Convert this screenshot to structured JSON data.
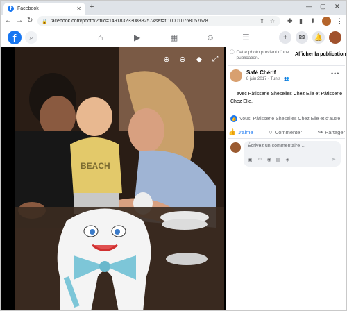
{
  "browser": {
    "tab_title": "Facebook",
    "tab_favicon": "f",
    "tab_close": "✕",
    "new_tab": "+",
    "url": "facebook.com/photo/?fbid=1491832330888257&set=t.100010768057678",
    "controls": {
      "minimize": "—",
      "maximize": "▢",
      "close": "✕"
    }
  },
  "fb_nav": {
    "logo": "f",
    "icons": [
      "home-icon",
      "watch-icon",
      "marketplace-icon",
      "groups-icon",
      "menu-icon"
    ]
  },
  "photo_overlay_icons": [
    "zoom-in-icon",
    "zoom-out-icon",
    "tag-icon",
    "fullscreen-icon"
  ],
  "panel": {
    "notice_text": "Cette photo provient d'une publication.",
    "show_post_label": "Afficher la publication",
    "author_name": "Safé Chérif",
    "post_date": "8 juin 2017 · Tunis ·",
    "post_text": "— avec Pâtisserie Sheselles Chez Elle et Pâtisserie Chez Elle.",
    "reactions_text": "Vous, Pâtisserie Sheselles Chez Elle et d'autre",
    "actions": {
      "like": "J'aime",
      "comment": "Commenter",
      "share": "Partager"
    },
    "comment_placeholder": "Écrivez un commentaire…"
  },
  "colors": {
    "facebook_blue": "#1877f2",
    "secondary_text": "#65676b",
    "photo_background": "#000000"
  }
}
